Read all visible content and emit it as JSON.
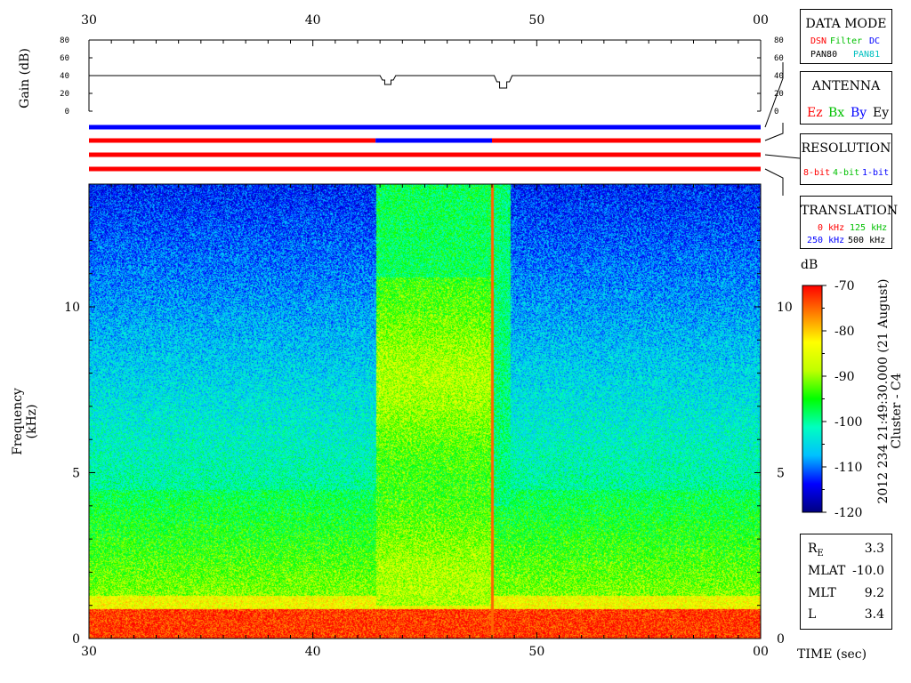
{
  "chart_data": {
    "type": "heatmap",
    "title": "",
    "xlabel": "TIME (sec)",
    "x_ticks": [
      "30",
      "40",
      "50",
      "00"
    ],
    "xlim": [
      30,
      60
    ],
    "ylabel": "Frequency (kHz)",
    "ylim": [
      0,
      13.7
    ],
    "y_ticks": [
      "0",
      "5",
      "10"
    ],
    "gain_panel": {
      "ylabel": "Gain (dB)",
      "ylim": [
        0,
        80
      ],
      "y_ticks": [
        "0",
        "20",
        "40",
        "60",
        "80"
      ],
      "baseline_db": 40,
      "dips": [
        {
          "start": 43.0,
          "end": 43.7,
          "min_db": 30
        },
        {
          "start": 48.1,
          "end": 48.9,
          "min_db": 26
        }
      ]
    },
    "colorbar": {
      "label": "dB",
      "min": -120,
      "max": -70,
      "ticks": [
        "-70",
        "-80",
        "-90",
        "-100",
        "-110",
        "-120"
      ],
      "colors": [
        "#000080",
        "#0000ff",
        "#00c0ff",
        "#00ffc0",
        "#00ff00",
        "#c0ff00",
        "#ffff00",
        "#ff8000",
        "#ff0000"
      ]
    },
    "status_bars": [
      {
        "name": "data_mode",
        "segments": [
          {
            "start": 30,
            "end": 60,
            "color": "#0000ff"
          }
        ]
      },
      {
        "name": "antenna",
        "segments": [
          {
            "start": 30,
            "end": 42.8,
            "color": "#ff0000"
          },
          {
            "start": 42.8,
            "end": 48.0,
            "color": "#0000ff"
          },
          {
            "start": 48.0,
            "end": 60,
            "color": "#ff0000"
          }
        ]
      },
      {
        "name": "resolution",
        "segments": [
          {
            "start": 30,
            "end": 60,
            "color": "#ff0000"
          }
        ]
      },
      {
        "name": "translation",
        "segments": [
          {
            "start": 30,
            "end": 60,
            "color": "#ff0000"
          }
        ]
      }
    ],
    "spectrogram_features": {
      "low_freq_red_band_khz": [
        0,
        0.9
      ],
      "enhanced_interval_sec": [
        42.8,
        48.0
      ],
      "enhanced_interval_top_khz": 10.9,
      "spike_time_sec": 48.0,
      "second_gap_sec": [
        48.0,
        48.8
      ]
    },
    "side_label": "2012 234 21:49:30.000 (21 August)",
    "spacecraft": "Cluster - C4"
  },
  "legend": {
    "data_mode": {
      "title": "DATA MODE",
      "items": [
        {
          "label": "DSN",
          "color": "#ff0000"
        },
        {
          "label": "Filter",
          "color": "#00c000"
        },
        {
          "label": "DC",
          "color": "#0000ff"
        },
        {
          "label": "PAN80",
          "color": "#000000"
        },
        {
          "label": "PAN81",
          "color": "#00c0c0"
        }
      ]
    },
    "antenna": {
      "title": "ANTENNA",
      "items": [
        {
          "label": "Ez",
          "color": "#ff0000"
        },
        {
          "label": "Bx",
          "color": "#00c000"
        },
        {
          "label": "By",
          "color": "#0000ff"
        },
        {
          "label": "Ey",
          "color": "#000000"
        }
      ]
    },
    "resolution": {
      "title": "RESOLUTION",
      "items": [
        {
          "label": "8-bit",
          "color": "#ff0000"
        },
        {
          "label": "4-bit",
          "color": "#00c000"
        },
        {
          "label": "1-bit",
          "color": "#0000ff"
        }
      ]
    },
    "translation": {
      "title": "TRANSLATION",
      "items": [
        {
          "label": "0 kHz",
          "color": "#ff0000"
        },
        {
          "label": "125 kHz",
          "color": "#00c000"
        },
        {
          "label": "250 kHz",
          "color": "#0000ff"
        },
        {
          "label": "500 kHz",
          "color": "#000000"
        }
      ]
    }
  },
  "ephemeris": {
    "rows": [
      {
        "key_main": "R",
        "key_sub": "E",
        "value": "3.3"
      },
      {
        "key_main": "MLAT",
        "key_sub": "",
        "value": "-10.0"
      },
      {
        "key_main": "MLT",
        "key_sub": "",
        "value": "9.2"
      },
      {
        "key_main": "L",
        "key_sub": "",
        "value": "3.4"
      }
    ]
  }
}
